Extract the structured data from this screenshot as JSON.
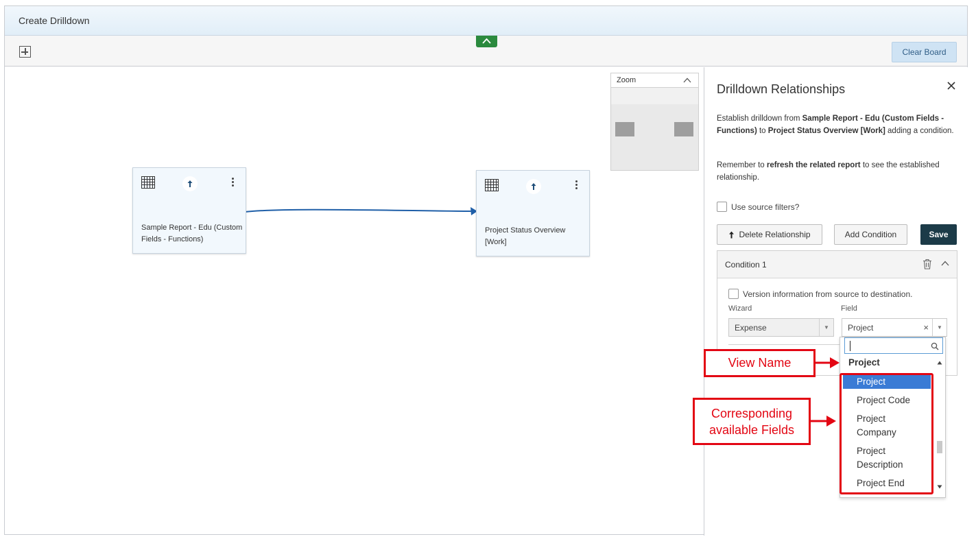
{
  "window": {
    "title": "Create Drilldown"
  },
  "toolbar": {
    "clear_board_label": "Clear Board"
  },
  "nodes": [
    {
      "name": "Sample Report - Edu (Custom Fields - Functions)"
    },
    {
      "name": "Project Status Overview [Work]"
    }
  ],
  "zoom": {
    "label": "Zoom"
  },
  "panel": {
    "title": "Drilldown Relationships",
    "desc_prefix": "Establish drilldown from ",
    "desc_source": "Sample Report - Edu (Custom Fields - Functions)",
    "desc_mid": " to ",
    "desc_target": "Project Status Overview [Work]",
    "desc_suffix": " adding a condition.",
    "note_prefix": "Remember to ",
    "note_bold": "refresh the related report",
    "note_suffix": " to see the established relationship.",
    "use_source_filters_label": "Use source filters?",
    "delete_relationship_label": "Delete Relationship",
    "add_condition_label": "Add Condition",
    "save_label": "Save"
  },
  "condition": {
    "title": "Condition 1",
    "version_info_label": "Version information from source to destination.",
    "wizard_label": "Wizard",
    "field_label": "Field",
    "wizard_value": "Expense",
    "field_value": "Project"
  },
  "dropdown": {
    "group": "Project",
    "items": [
      "Project",
      "Project Code",
      "Project Company",
      "Project Description",
      "Project End"
    ],
    "selected_index": 0
  },
  "callouts": {
    "view_name": "View Name",
    "fields": "Corresponding available Fields"
  },
  "colors": {
    "accent_dark": "#1c3b48",
    "selection": "#3a7bd5",
    "annotation": "#e30613",
    "connector": "#1f5fa8"
  }
}
